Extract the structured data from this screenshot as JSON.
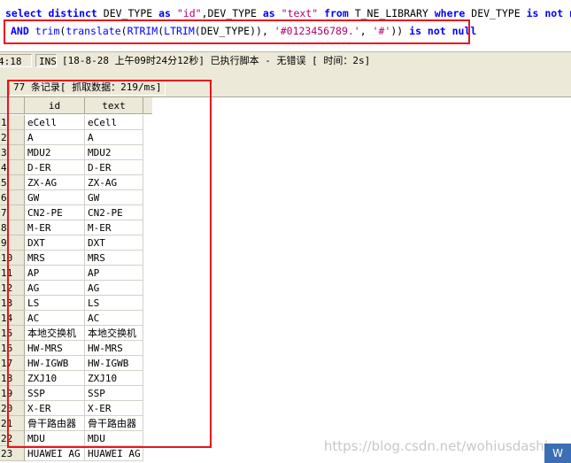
{
  "editor": {
    "line1": [
      {
        "t": "select distinct ",
        "c": "kw"
      },
      {
        "t": "DEV_TYPE ",
        "c": "txt"
      },
      {
        "t": "as ",
        "c": "kw"
      },
      {
        "t": "\"id\"",
        "c": "str"
      },
      {
        "t": ",DEV_TYPE ",
        "c": "txt"
      },
      {
        "t": "as ",
        "c": "kw"
      },
      {
        "t": "\"text\" ",
        "c": "str"
      },
      {
        "t": "from ",
        "c": "kw"
      },
      {
        "t": "T_NE_LIBRARY ",
        "c": "txt"
      },
      {
        "t": "where ",
        "c": "kw"
      },
      {
        "t": "DEV_TYPE ",
        "c": "txt"
      },
      {
        "t": "is not null",
        "c": "kw"
      }
    ],
    "line2": [
      {
        "t": "AND ",
        "c": "kw"
      },
      {
        "t": "trim",
        "c": "fn"
      },
      {
        "t": "(",
        "c": "txt"
      },
      {
        "t": "translate",
        "c": "fn"
      },
      {
        "t": "(",
        "c": "txt"
      },
      {
        "t": "RTRIM",
        "c": "fn"
      },
      {
        "t": "(",
        "c": "txt"
      },
      {
        "t": "LTRIM",
        "c": "fn"
      },
      {
        "t": "(DEV_TYPE)), ",
        "c": "txt"
      },
      {
        "t": "'#0123456789.'",
        "c": "str"
      },
      {
        "t": ", ",
        "c": "txt"
      },
      {
        "t": "'#'",
        "c": "str"
      },
      {
        "t": ")) ",
        "c": "txt"
      },
      {
        "t": "is not null",
        "c": "kw"
      }
    ]
  },
  "statusbar": {
    "position": "4:18",
    "mode": "INS",
    "message": "[18-8-28 上午09时24分12秒] 已执行脚本 - 无错误 [ 时间：2s]"
  },
  "results": {
    "info": "77 条记录[ 抓取数据：219/ms]",
    "columns": [
      "id",
      "text"
    ],
    "rows": [
      [
        "1",
        "eCell",
        "eCell"
      ],
      [
        "2",
        "A",
        "A"
      ],
      [
        "3",
        "MDU2",
        "MDU2"
      ],
      [
        "4",
        "D-ER",
        "D-ER"
      ],
      [
        "5",
        "ZX-AG",
        "ZX-AG"
      ],
      [
        "6",
        "GW",
        "GW"
      ],
      [
        "7",
        "CN2-PE",
        "CN2-PE"
      ],
      [
        "8",
        "M-ER",
        "M-ER"
      ],
      [
        "9",
        "DXT",
        "DXT"
      ],
      [
        "10",
        "MRS",
        "MRS"
      ],
      [
        "11",
        "AP",
        "AP"
      ],
      [
        "12",
        "AG",
        "AG"
      ],
      [
        "13",
        "LS",
        "LS"
      ],
      [
        "14",
        "AC",
        "AC"
      ],
      [
        "15",
        "本地交换机",
        "本地交换机"
      ],
      [
        "16",
        "HW-MRS",
        "HW-MRS"
      ],
      [
        "17",
        "HW-IGWB",
        "HW-IGWB"
      ],
      [
        "18",
        "ZXJ10",
        "ZXJ10"
      ],
      [
        "19",
        "SSP",
        "SSP"
      ],
      [
        "20",
        "X-ER",
        "X-ER"
      ],
      [
        "21",
        "骨干路由器",
        "骨干路由器"
      ],
      [
        "22",
        "MDU",
        "MDU"
      ],
      [
        "23",
        "HUAWEI AG",
        "HUAWEI AG"
      ]
    ]
  },
  "watermark": "https://blog.csdn.net/wohiusdashi",
  "corner_badge": "W",
  "colors": {
    "highlight": "#e8141c",
    "keyword": "#0000ff",
    "string": "#b4006e"
  }
}
